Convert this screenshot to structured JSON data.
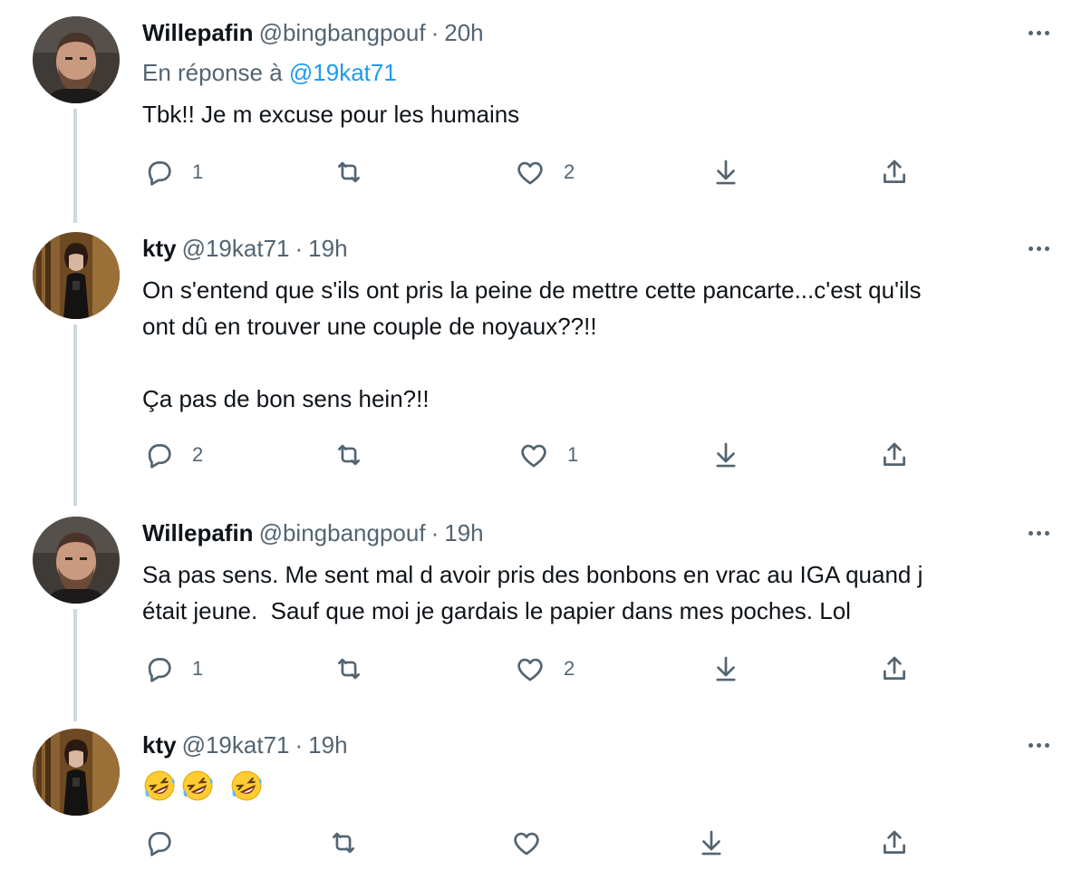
{
  "tweets": [
    {
      "name": "Willepafin",
      "handle": "@bingbangpouf",
      "sep": "·",
      "time": "20h",
      "reply_prefix": "En réponse à",
      "reply_mention": "@19kat71",
      "text": "Tbk!! Je m excuse pour les humains",
      "replies": "1",
      "retweets": "",
      "likes": "2"
    },
    {
      "name": "kty",
      "handle": "@19kat71",
      "sep": "·",
      "time": "19h",
      "text": "On s'entend que s'ils ont pris la peine de mettre cette pancarte...c'est qu'ils\nont dû en trouver une couple de noyaux??!!\n\nÇa pas de bon sens hein?!!",
      "replies": "2",
      "retweets": "",
      "likes": "1"
    },
    {
      "name": "Willepafin",
      "handle": "@bingbangpouf",
      "sep": "·",
      "time": "19h",
      "text": "Sa pas sens. Me sent mal d avoir pris des bonbons en vrac au IGA quand j\nétait jeune.  Sauf que moi je gardais le papier dans mes poches. Lol",
      "replies": "1",
      "retweets": "",
      "likes": "2"
    },
    {
      "name": "kty",
      "handle": "@19kat71",
      "sep": "·",
      "time": "19h",
      "emoji": [
        "rolling-on-floor-laughing",
        "rolling-on-floor-laughing",
        "rolling-on-floor-laughing"
      ],
      "replies": "",
      "retweets": "",
      "likes": ""
    }
  ],
  "icons": {
    "reply": "reply-icon",
    "retweet": "retweet-icon",
    "like": "heart-icon",
    "bookmark": "bookmark-down-arrow-icon",
    "share": "share-icon",
    "more": "more-dots-icon"
  },
  "colors": {
    "text": "#0f1419",
    "secondary": "#536471",
    "link": "#1d9bf0",
    "thread_line": "#cfd9de"
  }
}
